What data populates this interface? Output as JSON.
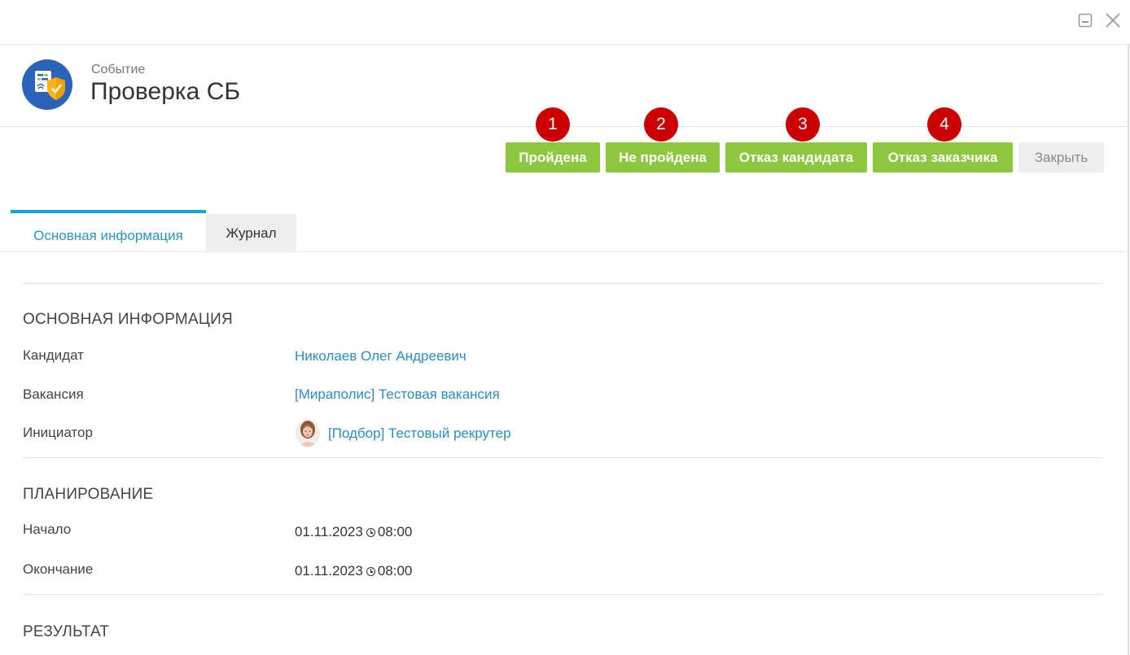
{
  "window": {
    "minimize_icon": "minimize-icon",
    "close_icon": "close-icon"
  },
  "header": {
    "event_type": "Событие",
    "title": "Проверка СБ",
    "logo_icon": "security-check-icon"
  },
  "actions": {
    "passed": "Пройдена",
    "not_passed": "Не пройдена",
    "candidate_refusal": "Отказ кандидата",
    "customer_refusal": "Отказ заказчика",
    "close": "Закрыть"
  },
  "annotations": [
    "1",
    "2",
    "3",
    "4"
  ],
  "tabs": {
    "main": "Основная информация",
    "journal": "Журнал"
  },
  "sections": {
    "main_info": {
      "title": "ОСНОВНАЯ ИНФОРМАЦИЯ",
      "candidate_label": "Кандидат",
      "candidate_value": "Николаев Олег Андреевич",
      "vacancy_label": "Вакансия",
      "vacancy_value": "[Мираполис] Тестовая вакансия",
      "initiator_label": "Инициатор",
      "initiator_value": "[Подбор] Тестовый рекрутер"
    },
    "planning": {
      "title": "ПЛАНИРОВАНИЕ",
      "start_label": "Начало",
      "start_date": "01.11.2023",
      "start_time": "08:00",
      "end_label": "Окончание",
      "end_date": "01.11.2023",
      "end_time": "08:00"
    },
    "result": {
      "title": "РЕЗУЛЬТАТ"
    }
  },
  "colors": {
    "primary_button": "#8dc63f",
    "link": "#2a8ec5",
    "tab_accent": "#19a4d6",
    "badge": "#cc0000"
  }
}
